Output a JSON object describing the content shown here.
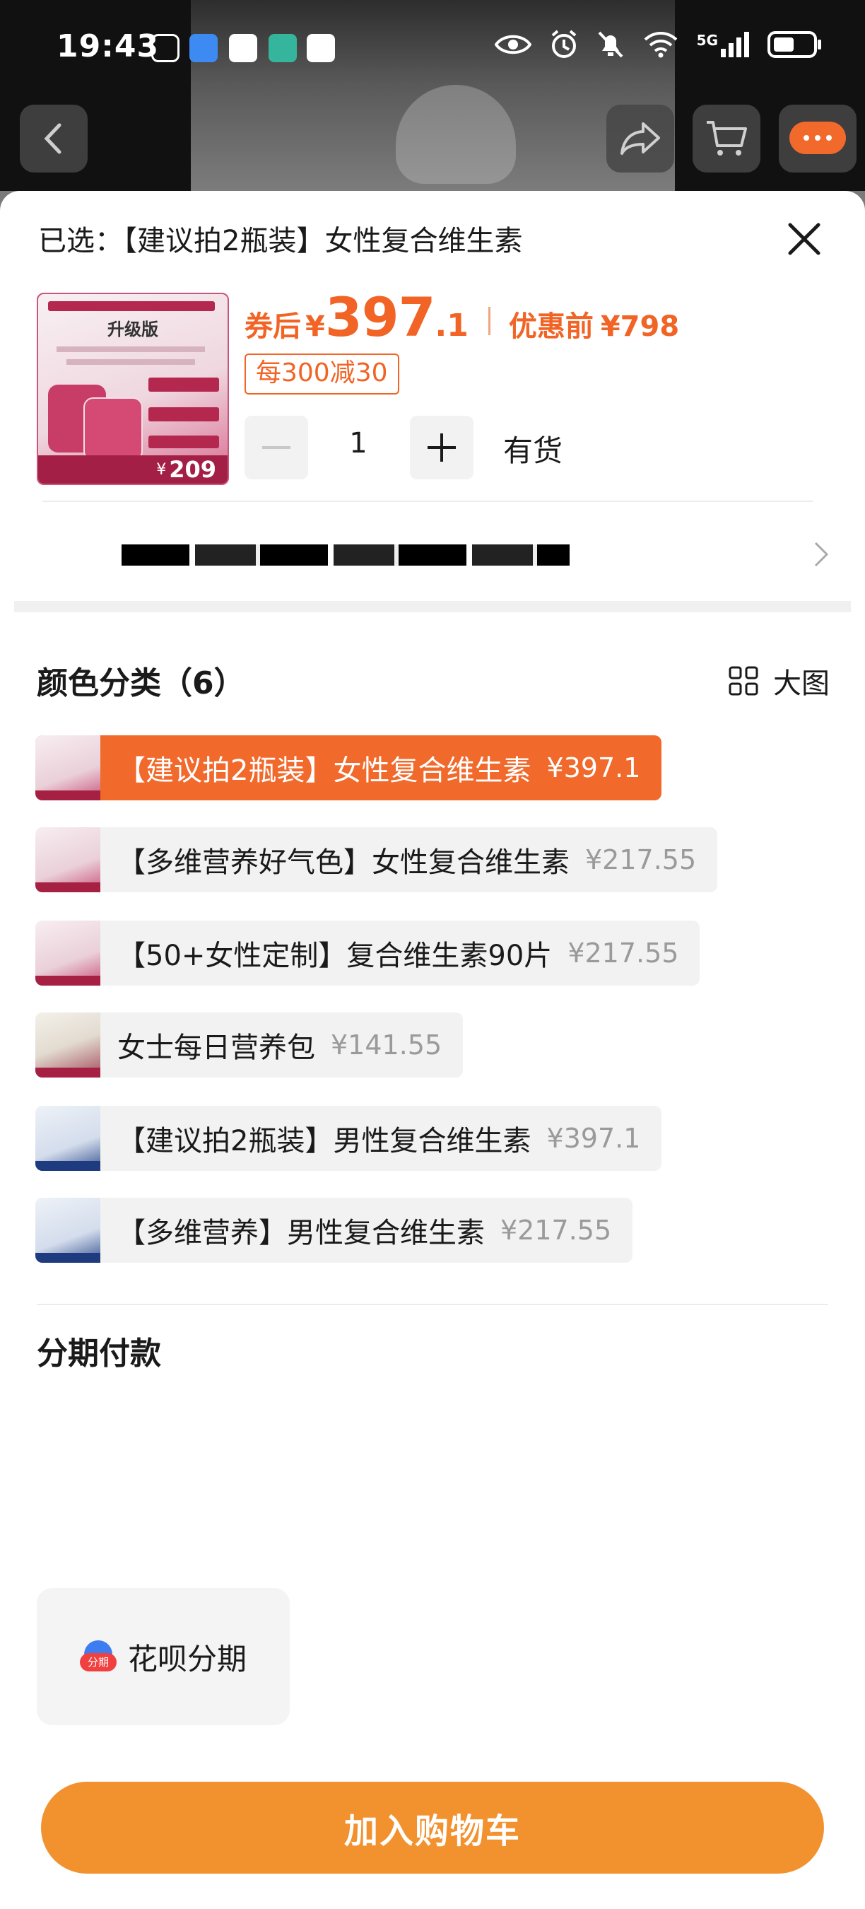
{
  "status_bar": {
    "time": "19:43",
    "network": "5G"
  },
  "colors": {
    "accent": "#f16425",
    "selected_option": "#f1692b",
    "cart_button": "#f2922f"
  },
  "header": {
    "selected_text": "已选：【建议拍2瓶装】女性复合维生素"
  },
  "product": {
    "thumb_badge": "升级版",
    "thumb_price": "209",
    "price_label": "券后",
    "currency": "¥",
    "price_int": "397",
    "price_dec": ".1",
    "original_label": "优惠前",
    "original_price": "¥798",
    "coupon": "每300减30",
    "quantity": "1",
    "stock_status": "有货"
  },
  "variants": {
    "title": "颜色分类（6）",
    "big_view_label": "大图",
    "items": [
      {
        "name": "【建议拍2瓶装】女性复合维生素",
        "price": "¥397.1"
      },
      {
        "name": "【多维营养好气色】女性复合维生素",
        "price": "¥217.55"
      },
      {
        "name": "【50+女性定制】复合维生素90片",
        "price": "¥217.55"
      },
      {
        "name": "女士每日营养包",
        "price": "¥141.55"
      },
      {
        "name": "【建议拍2瓶装】男性复合维生素",
        "price": "¥397.1"
      },
      {
        "name": "【多维营养】男性复合维生素",
        "price": "¥217.55"
      }
    ]
  },
  "installment": {
    "title": "分期付款",
    "option_label": "花呗分期",
    "icon_text": "分期"
  },
  "footer": {
    "add_to_cart": "加入购物车"
  }
}
